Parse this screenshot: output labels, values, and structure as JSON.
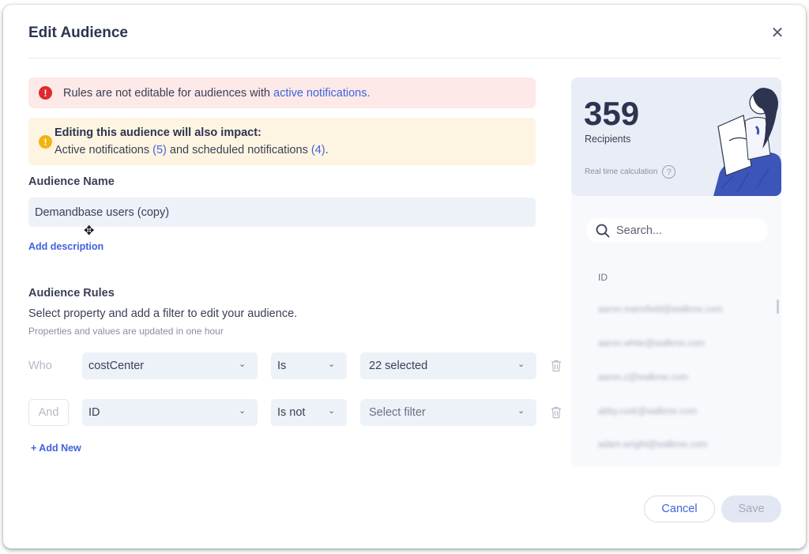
{
  "dialog": {
    "title": "Edit Audience"
  },
  "error_alert": {
    "text": "Rules are not editable for audiences with ",
    "link": "active notifications."
  },
  "warning_alert": {
    "title": "Editing this audience will also impact:",
    "text_a": "Active notifications ",
    "count_active": "(5)",
    "text_b": " and scheduled notifications ",
    "count_scheduled": "(4)",
    "text_c": "."
  },
  "audience_name": {
    "label": "Audience Name",
    "value": "Demandbase users (copy)",
    "add_description": "Add description"
  },
  "rules": {
    "label": "Audience Rules",
    "description": "Select property and add a filter to edit your audience.",
    "hint": "Properties and values are updated in one hour",
    "rows": [
      {
        "prefix": "Who",
        "property": "costCenter",
        "operator": "Is",
        "value": "22 selected"
      },
      {
        "prefix": "And",
        "property": "ID",
        "operator": "Is not",
        "value": "Select filter"
      }
    ],
    "add_new": "+ Add New"
  },
  "stats": {
    "count": "359",
    "label": "Recipients",
    "realtime": "Real time calculation",
    "help": "?"
  },
  "recipients_list": {
    "search_placeholder": "Search...",
    "column": "ID",
    "rows": [
      "aaron.mansfield@walkme.com",
      "aaron.white@walkme.com",
      "aaron.z@walkme.com",
      "abby.runk@walkme.com",
      "adam.wright@walkme.com"
    ]
  },
  "footer": {
    "cancel": "Cancel",
    "save": "Save"
  },
  "colors": {
    "accent": "#3f63dd",
    "error": "#e0282e",
    "warning": "#f2b411"
  }
}
